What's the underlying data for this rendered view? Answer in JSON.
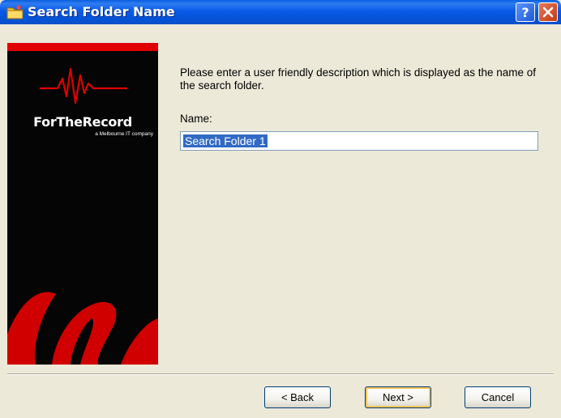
{
  "window": {
    "title": "Search Folder Name",
    "help_icon": "question-mark-icon",
    "close_icon": "close-x-icon"
  },
  "sidebar": {
    "brand": "ForTheRecord",
    "tagline": "a Melbourne IT company",
    "accent_color": "#e00000"
  },
  "form": {
    "prompt": "Please enter a user friendly description which is displayed as the name of the search folder.",
    "name_label": "Name:",
    "name_value": "Search Folder 1"
  },
  "buttons": {
    "back": "< Back",
    "next": "Next >",
    "cancel": "Cancel"
  }
}
